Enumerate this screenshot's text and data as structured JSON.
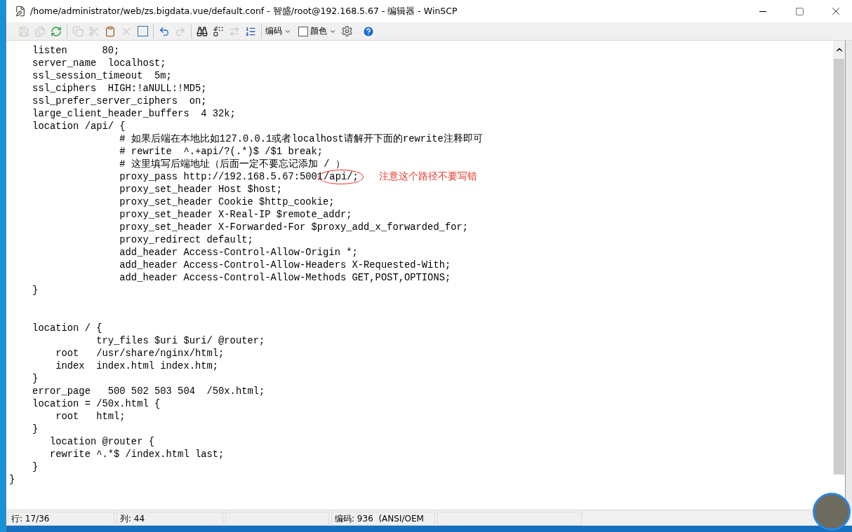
{
  "window": {
    "title": "/home/administrator/web/zs.bigdata.vue/default.conf - 智盛/root@192.168.5.67 - 编辑器 - WinSCP"
  },
  "toolbar": {
    "groups": [
      [
        {
          "kind": "save",
          "disabled": true
        },
        {
          "kind": "save-all",
          "disabled": true
        },
        {
          "kind": "reload",
          "disabled": false
        }
      ],
      [
        {
          "kind": "copy",
          "disabled": true
        },
        {
          "kind": "cut",
          "disabled": true
        },
        {
          "kind": "paste",
          "disabled": false
        },
        {
          "kind": "delete",
          "disabled": true
        },
        {
          "kind": "select-all",
          "disabled": false
        }
      ],
      [
        {
          "kind": "undo",
          "disabled": false
        },
        {
          "kind": "redo",
          "disabled": true
        }
      ],
      [
        {
          "kind": "find",
          "disabled": false
        },
        {
          "kind": "replace",
          "disabled": false
        },
        {
          "kind": "find-next",
          "disabled": true
        },
        {
          "kind": "goto-line",
          "disabled": false
        }
      ]
    ],
    "encoding_menu": {
      "label": "编码"
    },
    "color_toggle": {
      "label": "颜色",
      "checked": false
    }
  },
  "editor": {
    "lines": [
      {
        "text": "    listen      80;"
      },
      {
        "text": "    server_name  localhost;"
      },
      {
        "text": "    ssl_session_timeout  5m;"
      },
      {
        "text": "    ssl_ciphers  HIGH:!aNULL:!MD5;"
      },
      {
        "text": "    ssl_prefer_server_ciphers  on;"
      },
      {
        "text": "    large_client_header_buffers  4 32k;"
      },
      {
        "text": "    location /api/ {"
      },
      {
        "text": "                   # 如果后端在本地比如127.0.0.1或者localhost请解开下面的rewrite注释即可"
      },
      {
        "text": "                   # rewrite  ^.+api/?(.*)$ /$1 break;"
      },
      {
        "text": "                   # 这里填写后端地址（后面一定不要忘记添加 / ）"
      },
      {
        "text": "                   proxy_pass http://192.168.5.67:5001",
        "circled": "/api/;",
        "note": "注意这个路径不要写错"
      },
      {
        "text": "                   proxy_set_header Host $host;"
      },
      {
        "text": "                   proxy_set_header Cookie $http_cookie;"
      },
      {
        "text": "                   proxy_set_header X-Real-IP $remote_addr;"
      },
      {
        "text": "                   proxy_set_header X-Forwarded-For $proxy_add_x_forwarded_for;"
      },
      {
        "text": "                   proxy_redirect default;"
      },
      {
        "text": "                   add_header Access-Control-Allow-Origin *;"
      },
      {
        "text": "                   add_header Access-Control-Allow-Headers X-Requested-With;"
      },
      {
        "text": "                   add_header Access-Control-Allow-Methods GET,POST,OPTIONS;"
      },
      {
        "text": "    }"
      },
      {
        "kind": "blank"
      },
      {
        "kind": "blank"
      },
      {
        "text": "    location / {"
      },
      {
        "text": "               try_files $uri $uri/ @router;"
      },
      {
        "text": "        root   /usr/share/nginx/html;"
      },
      {
        "text": "        index  index.html index.htm;"
      },
      {
        "text": "    }"
      },
      {
        "text": "    error_page   500 502 503 504  /50x.html;"
      },
      {
        "text": "    location = /50x.html {"
      },
      {
        "text": "        root   html;"
      },
      {
        "text": "    }"
      },
      {
        "text": "       location @router {"
      },
      {
        "text": "       rewrite ^.*$ /index.html last;"
      },
      {
        "text": "    }"
      },
      {
        "text": "}"
      }
    ]
  },
  "status_bar": [
    {
      "kind": "text",
      "text": "行: 17/36"
    },
    {
      "kind": "text",
      "text": "列: 44"
    },
    {
      "kind": "empty"
    },
    {
      "kind": "text",
      "text": "编码: 936  (ANSI/OEM"
    },
    {
      "kind": "empty"
    }
  ]
}
